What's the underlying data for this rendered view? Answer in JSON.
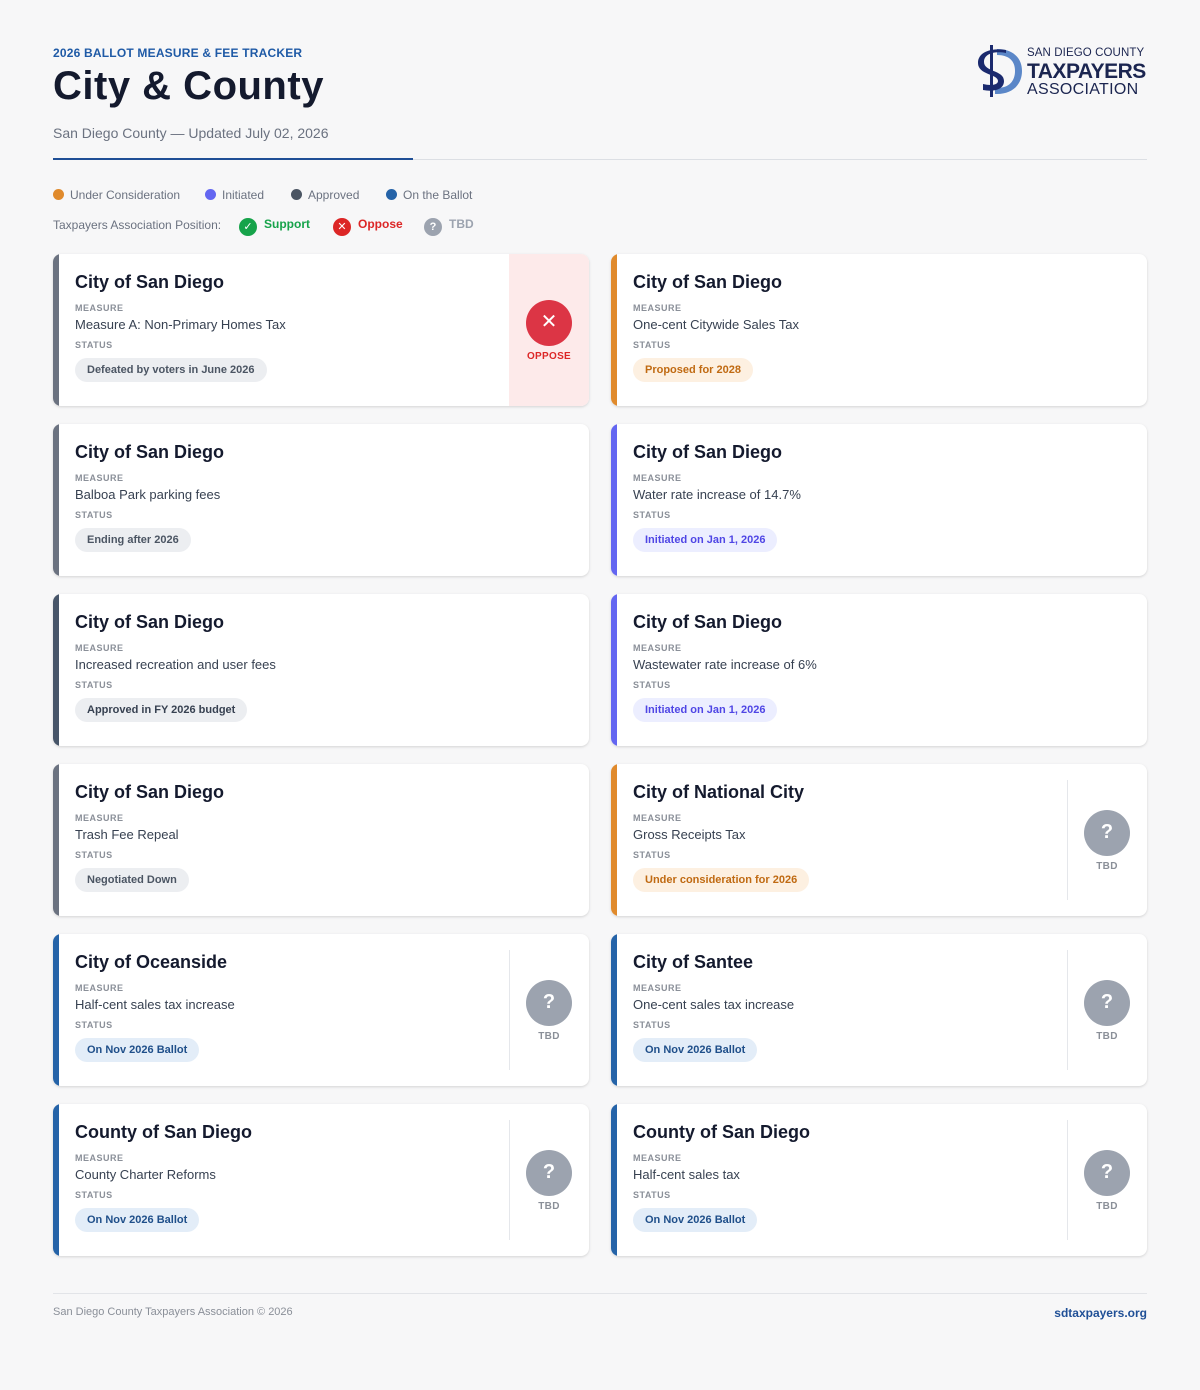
{
  "header": {
    "eyebrow": "2026 BALLOT MEASURE & FEE TRACKER",
    "title": "City & County",
    "subtitle": "San Diego County — Updated July 02, 2026"
  },
  "logo": {
    "line1": "SAN DIEGO COUNTY",
    "line2": "TAXPAYERS",
    "line3": "ASSOCIATION",
    "mark": "$D"
  },
  "legend": [
    {
      "label": "Under Consideration",
      "color": "#e08a2c"
    },
    {
      "label": "Initiated",
      "color": "#6366f1"
    },
    {
      "label": "Approved",
      "color": "#4b5563"
    },
    {
      "label": "On the Ballot",
      "color": "#2563a8"
    }
  ],
  "positions": {
    "label": "Taxpayers Association Position:",
    "support": {
      "label": "Support",
      "color": "#16a34a",
      "icon": "check-icon"
    },
    "oppose": {
      "label": "Oppose",
      "color": "#dc2626",
      "icon": "x-icon"
    },
    "tbd": {
      "label": "TBD",
      "color": "#9ca3af",
      "icon": "question-icon"
    }
  },
  "labels": {
    "measure": "MEASURE",
    "status": "STATUS"
  },
  "cards": [
    {
      "jurisdiction": "City of San Diego",
      "measure": "Measure A: Non-Primary Homes Tax",
      "status": "Defeated by voters in June 2026",
      "category": "defeated",
      "position": "OPPOSE"
    },
    {
      "jurisdiction": "City of San Diego",
      "measure": "One-cent Citywide Sales Tax",
      "status": "Proposed for 2028",
      "category": "under-consideration",
      "position": ""
    },
    {
      "jurisdiction": "City of San Diego",
      "measure": "Balboa Park parking fees",
      "status": "Ending after 2026",
      "category": "defeated",
      "position": ""
    },
    {
      "jurisdiction": "City of San Diego",
      "measure": "Water rate increase of 14.7%",
      "status": "Initiated on Jan 1, 2026",
      "category": "initiated",
      "position": ""
    },
    {
      "jurisdiction": "City of San Diego",
      "measure": "Increased recreation and user fees",
      "status": "Approved in FY 2026 budget",
      "category": "approved",
      "position": ""
    },
    {
      "jurisdiction": "City of San Diego",
      "measure": "Wastewater rate increase of 6%",
      "status": "Initiated on Jan 1, 2026",
      "category": "initiated",
      "position": ""
    },
    {
      "jurisdiction": "City of San Diego",
      "measure": "Trash Fee Repeal",
      "status": "Negotiated Down",
      "category": "defeated",
      "position": ""
    },
    {
      "jurisdiction": "City of National City",
      "measure": "Gross Receipts Tax",
      "status": "Under consideration for 2026",
      "category": "under-consideration",
      "position": "TBD"
    },
    {
      "jurisdiction": "City of Oceanside",
      "measure": "Half-cent sales tax increase",
      "status": "On Nov 2026 Ballot",
      "category": "ballot",
      "position": "TBD"
    },
    {
      "jurisdiction": "City of Santee",
      "measure": "One-cent sales tax increase",
      "status": "On Nov 2026 Ballot",
      "category": "ballot",
      "position": "TBD"
    },
    {
      "jurisdiction": "County of San Diego",
      "measure": "County Charter Reforms",
      "status": "On Nov 2026 Ballot",
      "category": "ballot",
      "position": "TBD"
    },
    {
      "jurisdiction": "County of San Diego",
      "measure": "Half-cent sales tax",
      "status": "On Nov 2026 Ballot",
      "category": "ballot",
      "position": "TBD"
    }
  ],
  "category_styles": {
    "defeated": {
      "bar": "#6b7280",
      "pill_bg": "#eceef1",
      "pill_fg": "#4b5563"
    },
    "approved": {
      "bar": "#475569",
      "pill_bg": "#eceef1",
      "pill_fg": "#374151"
    },
    "under-consideration": {
      "bar": "#e08a2c",
      "pill_bg": "#fdf0e1",
      "pill_fg": "#c06a12"
    },
    "initiated": {
      "bar": "#6366f1",
      "pill_bg": "#eceeff",
      "pill_fg": "#4f46e5"
    },
    "ballot": {
      "bar": "#2563a8",
      "pill_bg": "#e3edf8",
      "pill_fg": "#1f4f8a"
    }
  },
  "footer": {
    "copyright": "San Diego County Taxpayers Association © 2026",
    "link": "sdtaxpayers.org"
  }
}
